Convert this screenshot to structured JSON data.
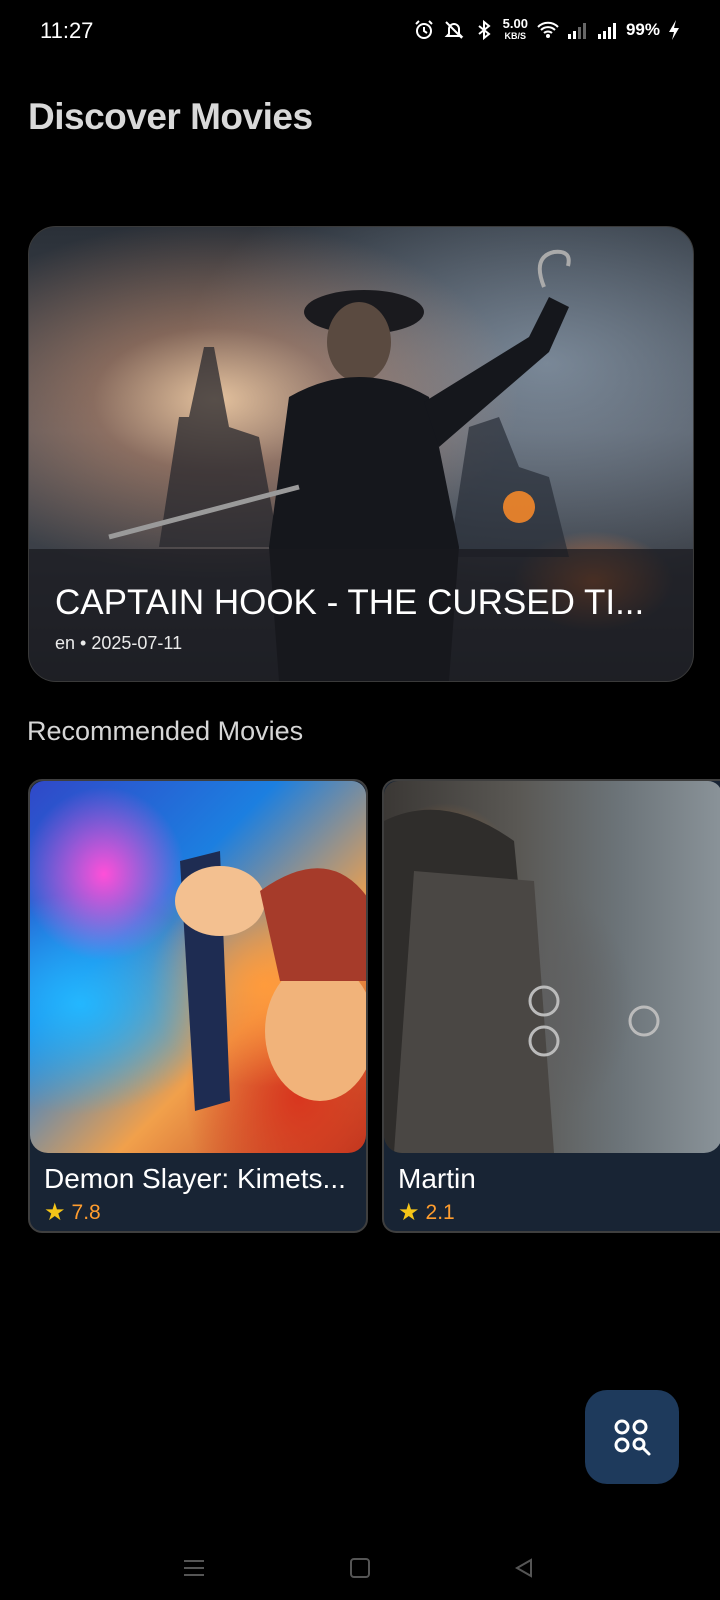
{
  "status_bar": {
    "time": "11:27",
    "net_speed_value": "5.00",
    "net_speed_unit": "KB/S",
    "battery": "99%",
    "icons": [
      "alarm-icon",
      "silent-icon",
      "bluetooth-icon",
      "wifi-icon",
      "signal-icon",
      "signal-icon",
      "charging-icon"
    ]
  },
  "header": {
    "title": "Discover Movies"
  },
  "featured": {
    "title": "CAPTAIN HOOK - THE CURSED TI...",
    "language": "en",
    "separator": "•",
    "release_date": "2025-07-11"
  },
  "recommended": {
    "section_title": "Recommended Movies",
    "movies": [
      {
        "title": "Demon Slayer: Kimets...",
        "rating": "7.8"
      },
      {
        "title": "Martin",
        "rating": "2.1"
      }
    ]
  },
  "fab": {
    "icon": "categories-search-icon"
  },
  "nav": {
    "icons": [
      "menu-icon",
      "home-icon",
      "back-icon"
    ]
  },
  "colors": {
    "background": "#000000",
    "card_bg": "#182434",
    "fab_bg": "#1e3a5c",
    "rating_text": "#ff9d2e",
    "star": "#f5c518"
  }
}
